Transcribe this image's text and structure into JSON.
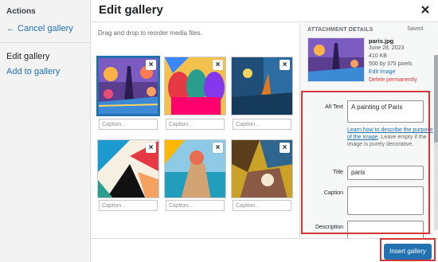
{
  "sidebar": {
    "title": "Actions",
    "cancel_label": "← Cancel gallery",
    "edit_label": "Edit gallery",
    "add_label": "Add to gallery"
  },
  "header": {
    "title": "Edit gallery",
    "close_icon": "close-icon"
  },
  "main": {
    "instructions": "Drag and drop to reorder media files.",
    "images": [
      {
        "caption_placeholder": "Caption...",
        "remove_label": "×"
      },
      {
        "caption_placeholder": "Caption...",
        "remove_label": "×"
      },
      {
        "caption_placeholder": "Caption...",
        "remove_label": "×"
      },
      {
        "caption_placeholder": "Caption...",
        "remove_label": "×"
      },
      {
        "caption_placeholder": "Caption...",
        "remove_label": "×"
      },
      {
        "caption_placeholder": "Caption...",
        "remove_label": "×"
      }
    ]
  },
  "details": {
    "heading": "ATTACHMENT DETAILS",
    "saved": "Saved.",
    "filename": "paris.jpg",
    "date": "June 28, 2023",
    "size": "410 KB",
    "dimensions": "500 by 375 pixels",
    "edit_link": "Edit Image",
    "delete_link": "Delete permanently",
    "alt_label": "Alt Text",
    "alt_value": "A painting of Paris",
    "help_link": "Learn how to describe the purpose of the image",
    "help_text": ". Leave empty if the image is purely decorative.",
    "title_label": "Title",
    "title_value": "paris",
    "caption_label": "Caption",
    "caption_value": "",
    "description_label": "Description",
    "description_value": ""
  },
  "footer": {
    "insert_label": "Insert gallery"
  },
  "colors": {
    "accent": "#2271b1",
    "highlight": "#d63638"
  }
}
